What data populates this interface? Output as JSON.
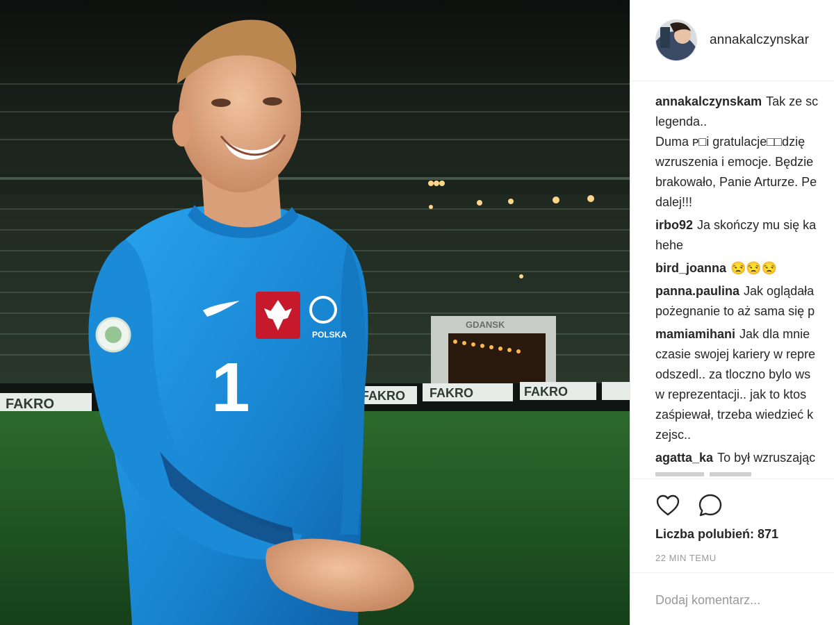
{
  "post": {
    "username": "annakalczynskar",
    "likes_text": "Liczba polubień: 871",
    "time_text": "22 MIN TEMU",
    "add_comment_placeholder": "Dodaj komentarz...",
    "photo": {
      "shirt_number": "1",
      "crest_text": "POLSKA",
      "board_text": "FAKRO",
      "stand_sign": "GDANSK"
    }
  },
  "comments": [
    {
      "author": "annakalczynskam",
      "lines": [
        "Tak ze sc",
        "legenda..",
        "Duma ᴘ□i gratulacje□□dzię",
        "wzruszenia i emocje. Będzie",
        "brakowało, Panie Arturze. Pe",
        "dalej!!!"
      ]
    },
    {
      "author": "irbo92",
      "lines": [
        "Ja skończy mu się ka",
        "hehe"
      ]
    },
    {
      "author": "bird_joanna",
      "lines": [
        "😒😒😒"
      ]
    },
    {
      "author": "panna.paulina",
      "lines": [
        "Jak oglądała",
        "pożegnanie to aż sama się p"
      ]
    },
    {
      "author": "mamiamihani",
      "lines": [
        "Jak dla mnie",
        "czasie swojej kariery w repre",
        "odszedl.. za tloczno bylo ws",
        "w reprezentacji.. jak to ktos",
        "zaśpiewał, trzeba wiedzieć k",
        "zejsc.."
      ]
    },
    {
      "author": "agatta_ka",
      "lines": [
        "To był wzruszając"
      ]
    }
  ],
  "icons": {
    "like": "heart-icon",
    "comment": "comment-bubble-icon"
  },
  "colors": {
    "text": "#262626",
    "muted": "#999999",
    "jersey": "#1e8fd8"
  }
}
